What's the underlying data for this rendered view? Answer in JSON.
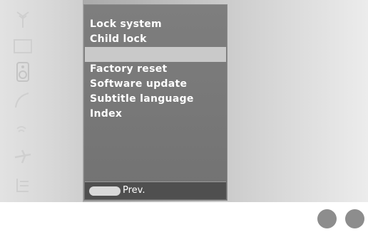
{
  "sidebar": {
    "icons": [
      "antenna-icon",
      "picture-icon",
      "speaker-icon",
      "gauge-icon",
      "signal-icon",
      "plane-icon",
      "source-icon"
    ]
  },
  "menu": {
    "items": [
      {
        "label": "Lock system"
      },
      {
        "label": "Child lock"
      },
      {
        "label": ""
      },
      {
        "label": "Factory reset"
      },
      {
        "label": "Software update"
      },
      {
        "label": "Subtitle language"
      },
      {
        "label": "Index"
      }
    ],
    "selected_index": 2
  },
  "footer": {
    "prev_label": "Prev."
  },
  "colors": {
    "menu_background": "#777777",
    "highlight": "#c9c9c9",
    "dot": "#8d8d8d"
  }
}
